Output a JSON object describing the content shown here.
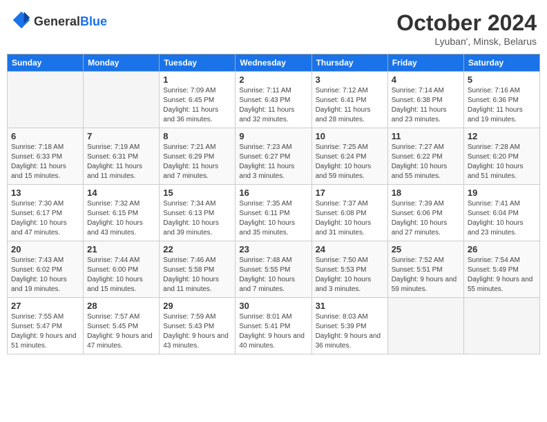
{
  "header": {
    "logo_line1": "General",
    "logo_line2": "Blue",
    "month_title": "October 2024",
    "subtitle": "Lyuban', Minsk, Belarus"
  },
  "days_of_week": [
    "Sunday",
    "Monday",
    "Tuesday",
    "Wednesday",
    "Thursday",
    "Friday",
    "Saturday"
  ],
  "weeks": [
    [
      {
        "day": "",
        "info": ""
      },
      {
        "day": "",
        "info": ""
      },
      {
        "day": "1",
        "info": "Sunrise: 7:09 AM\nSunset: 6:45 PM\nDaylight: 11 hours and 36 minutes."
      },
      {
        "day": "2",
        "info": "Sunrise: 7:11 AM\nSunset: 6:43 PM\nDaylight: 11 hours and 32 minutes."
      },
      {
        "day": "3",
        "info": "Sunrise: 7:12 AM\nSunset: 6:41 PM\nDaylight: 11 hours and 28 minutes."
      },
      {
        "day": "4",
        "info": "Sunrise: 7:14 AM\nSunset: 6:38 PM\nDaylight: 11 hours and 23 minutes."
      },
      {
        "day": "5",
        "info": "Sunrise: 7:16 AM\nSunset: 6:36 PM\nDaylight: 11 hours and 19 minutes."
      }
    ],
    [
      {
        "day": "6",
        "info": "Sunrise: 7:18 AM\nSunset: 6:33 PM\nDaylight: 11 hours and 15 minutes."
      },
      {
        "day": "7",
        "info": "Sunrise: 7:19 AM\nSunset: 6:31 PM\nDaylight: 11 hours and 11 minutes."
      },
      {
        "day": "8",
        "info": "Sunrise: 7:21 AM\nSunset: 6:29 PM\nDaylight: 11 hours and 7 minutes."
      },
      {
        "day": "9",
        "info": "Sunrise: 7:23 AM\nSunset: 6:27 PM\nDaylight: 11 hours and 3 minutes."
      },
      {
        "day": "10",
        "info": "Sunrise: 7:25 AM\nSunset: 6:24 PM\nDaylight: 10 hours and 59 minutes."
      },
      {
        "day": "11",
        "info": "Sunrise: 7:27 AM\nSunset: 6:22 PM\nDaylight: 10 hours and 55 minutes."
      },
      {
        "day": "12",
        "info": "Sunrise: 7:28 AM\nSunset: 6:20 PM\nDaylight: 10 hours and 51 minutes."
      }
    ],
    [
      {
        "day": "13",
        "info": "Sunrise: 7:30 AM\nSunset: 6:17 PM\nDaylight: 10 hours and 47 minutes."
      },
      {
        "day": "14",
        "info": "Sunrise: 7:32 AM\nSunset: 6:15 PM\nDaylight: 10 hours and 43 minutes."
      },
      {
        "day": "15",
        "info": "Sunrise: 7:34 AM\nSunset: 6:13 PM\nDaylight: 10 hours and 39 minutes."
      },
      {
        "day": "16",
        "info": "Sunrise: 7:35 AM\nSunset: 6:11 PM\nDaylight: 10 hours and 35 minutes."
      },
      {
        "day": "17",
        "info": "Sunrise: 7:37 AM\nSunset: 6:08 PM\nDaylight: 10 hours and 31 minutes."
      },
      {
        "day": "18",
        "info": "Sunrise: 7:39 AM\nSunset: 6:06 PM\nDaylight: 10 hours and 27 minutes."
      },
      {
        "day": "19",
        "info": "Sunrise: 7:41 AM\nSunset: 6:04 PM\nDaylight: 10 hours and 23 minutes."
      }
    ],
    [
      {
        "day": "20",
        "info": "Sunrise: 7:43 AM\nSunset: 6:02 PM\nDaylight: 10 hours and 19 minutes."
      },
      {
        "day": "21",
        "info": "Sunrise: 7:44 AM\nSunset: 6:00 PM\nDaylight: 10 hours and 15 minutes."
      },
      {
        "day": "22",
        "info": "Sunrise: 7:46 AM\nSunset: 5:58 PM\nDaylight: 10 hours and 11 minutes."
      },
      {
        "day": "23",
        "info": "Sunrise: 7:48 AM\nSunset: 5:55 PM\nDaylight: 10 hours and 7 minutes."
      },
      {
        "day": "24",
        "info": "Sunrise: 7:50 AM\nSunset: 5:53 PM\nDaylight: 10 hours and 3 minutes."
      },
      {
        "day": "25",
        "info": "Sunrise: 7:52 AM\nSunset: 5:51 PM\nDaylight: 9 hours and 59 minutes."
      },
      {
        "day": "26",
        "info": "Sunrise: 7:54 AM\nSunset: 5:49 PM\nDaylight: 9 hours and 55 minutes."
      }
    ],
    [
      {
        "day": "27",
        "info": "Sunrise: 7:55 AM\nSunset: 5:47 PM\nDaylight: 9 hours and 51 minutes."
      },
      {
        "day": "28",
        "info": "Sunrise: 7:57 AM\nSunset: 5:45 PM\nDaylight: 9 hours and 47 minutes."
      },
      {
        "day": "29",
        "info": "Sunrise: 7:59 AM\nSunset: 5:43 PM\nDaylight: 9 hours and 43 minutes."
      },
      {
        "day": "30",
        "info": "Sunrise: 8:01 AM\nSunset: 5:41 PM\nDaylight: 9 hours and 40 minutes."
      },
      {
        "day": "31",
        "info": "Sunrise: 8:03 AM\nSunset: 5:39 PM\nDaylight: 9 hours and 36 minutes."
      },
      {
        "day": "",
        "info": ""
      },
      {
        "day": "",
        "info": ""
      }
    ]
  ]
}
